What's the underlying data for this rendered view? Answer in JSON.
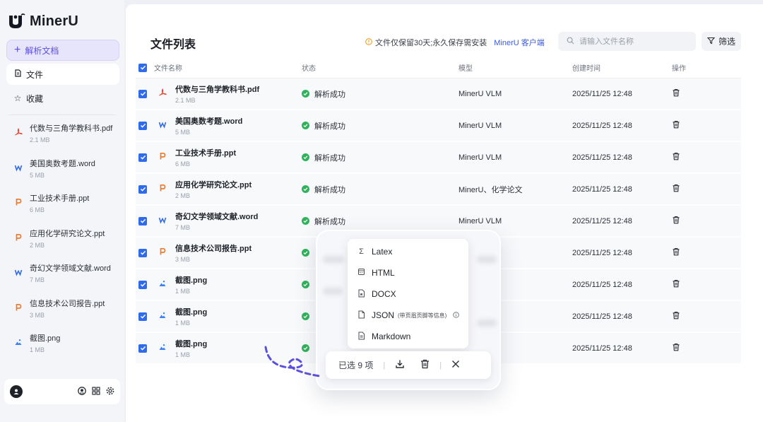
{
  "app": {
    "name": "MinerU"
  },
  "sidebar": {
    "new_button": "解析文档",
    "nav": [
      {
        "label": "文件",
        "icon": "document-icon",
        "active": true
      },
      {
        "label": "收藏",
        "icon": "star-icon",
        "active": false
      }
    ],
    "files": [
      {
        "name": "代数与三角学教科书.pdf",
        "size": "2.1 MB",
        "type": "pdf"
      },
      {
        "name": "美国奥数考题.word",
        "size": "5 MB",
        "type": "word"
      },
      {
        "name": "工业技术手册.ppt",
        "size": "6 MB",
        "type": "ppt"
      },
      {
        "name": "应用化学研究论文.ppt",
        "size": "2 MB",
        "type": "ppt"
      },
      {
        "name": "奇幻文学领域文献.word",
        "size": "7 MB",
        "type": "word"
      },
      {
        "name": "信息技术公司报告.ppt",
        "size": "3 MB",
        "type": "ppt"
      },
      {
        "name": "截图.png",
        "size": "1 MB",
        "type": "png"
      }
    ]
  },
  "header": {
    "title": "文件列表",
    "notice": "文件仅保留30天;永久保存需安装",
    "notice_link": "MinerU 客户端",
    "search_placeholder": "请输入文件名称",
    "filter_label": "筛选"
  },
  "table": {
    "columns": {
      "name": "文件名称",
      "status": "状态",
      "model": "模型",
      "created": "创建时间",
      "action": "操作"
    },
    "rows": [
      {
        "name": "代数与三角学教科书.pdf",
        "size": "2.1 MB",
        "type": "pdf",
        "status": "解析成功",
        "model": "MinerU VLM",
        "created": "2025/11/25  12:48"
      },
      {
        "name": "美国奥数考题.word",
        "size": "5 MB",
        "type": "word",
        "status": "解析成功",
        "model": "MinerU VLM",
        "created": "2025/11/25  12:48"
      },
      {
        "name": "工业技术手册.ppt",
        "size": "6 MB",
        "type": "ppt",
        "status": "解析成功",
        "model": "MinerU VLM",
        "created": "2025/11/25  12:48"
      },
      {
        "name": "应用化学研究论文.ppt",
        "size": "2 MB",
        "type": "ppt",
        "status": "解析成功",
        "model": "MinerU、化学论文",
        "created": "2025/11/25  12:48"
      },
      {
        "name": "奇幻文学领域文献.word",
        "size": "7 MB",
        "type": "word",
        "status": "解析成功",
        "model": "MinerU VLM",
        "created": "2025/11/25  12:48"
      },
      {
        "name": "信息技术公司报告.ppt",
        "size": "3 MB",
        "type": "ppt",
        "status": "",
        "model": "",
        "created": "2025/11/25  12:48"
      },
      {
        "name": "截图.png",
        "size": "1 MB",
        "type": "png",
        "status": "",
        "model": "",
        "created": "2025/11/25  12:48"
      },
      {
        "name": "截图.png",
        "size": "1 MB",
        "type": "png",
        "status": "",
        "model": "",
        "created": "2025/11/25  12:48"
      },
      {
        "name": "截图.png",
        "size": "1 MB",
        "type": "png",
        "status": "",
        "model": "",
        "created": "2025/11/25  12:48"
      }
    ]
  },
  "export_menu": {
    "items": [
      {
        "label": "Latex",
        "icon": "sigma-icon"
      },
      {
        "label": "HTML",
        "icon": "html-file-icon"
      },
      {
        "label": "DOCX",
        "icon": "docx-file-icon"
      },
      {
        "label": "JSON",
        "sub": "(带页眉页脚等信息)",
        "icon": "json-file-icon"
      },
      {
        "label": "Markdown",
        "icon": "markdown-file-icon"
      }
    ]
  },
  "selection_bar": {
    "label": "已选 9 项"
  },
  "colors": {
    "accent": "#2f6bea",
    "brand_purple": "#5b4fe0",
    "success": "#2fb35a",
    "warning": "#f0a020",
    "pdf": "#e5483a",
    "word": "#2f6bea",
    "ppt": "#f07a2a",
    "png": "#3b82f6"
  }
}
